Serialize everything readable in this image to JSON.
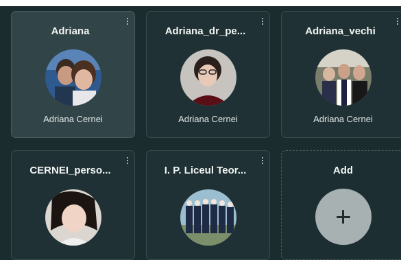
{
  "profiles": [
    {
      "title": "Adriana",
      "user": "Adriana Cernei"
    },
    {
      "title": "Adriana_dr_pe...",
      "user": "Adriana Cernei"
    },
    {
      "title": "Adriana_vechi",
      "user": "Adriana Cernei"
    },
    {
      "title": "CERNEI_perso...",
      "user": ""
    },
    {
      "title": "I. P. Liceul Teor...",
      "user": ""
    }
  ],
  "add": {
    "label": "Add",
    "icon": "plus-icon"
  },
  "icons": {
    "menu": "more-vertical-icon"
  },
  "colors": {
    "background": "#1b2c2f",
    "card": "#1f3134",
    "card_selected": "#314447",
    "add_button": "#a7b1b2"
  }
}
